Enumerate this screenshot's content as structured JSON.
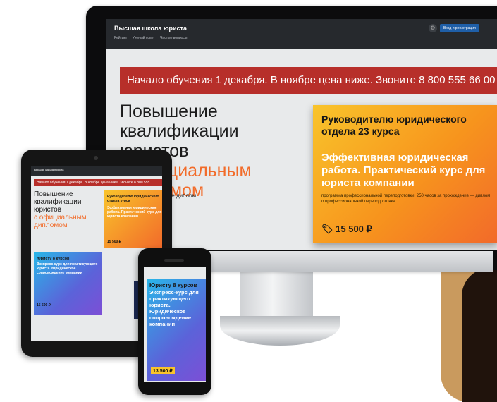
{
  "desktop": {
    "brand": "Высшая школа юриста",
    "nav_links": [
      "Рейтинг",
      "Ученый совет",
      "Частые вопросы"
    ],
    "login_label": "Вход и регистрация",
    "banner": "Начало обучения 1 декабря. В ноябре цена ниже. Звоните 8 800 555 66 00",
    "headline_black": "Повышение квалификации юристов",
    "headline_orange": "с официальным дипломом",
    "description": "программу, получите диплом",
    "card": {
      "title": "Руководителю юридического отдела 23 курса",
      "subtitle": "Эффективная юридическая работа. Практический курс для юриста компании",
      "note": "программа профессиональной переподготовки, 250 часов за прохождение — диплом о профессиональной переподготовке",
      "price": "15 500 ₽"
    }
  },
  "tablet": {
    "brand": "Высшая школа юриста",
    "banner": "Начало обучения 1 декабря. В ноябре цена ниже. Звоните 8 800 555",
    "headline_black": "Повышение квалификации юристов",
    "headline_orange": "с официальным дипломом",
    "card1_title": "Руководителю юридического отдела курса",
    "card1_sub": "Эффективная юридическая работа. Практический курс для юриста компании",
    "card1_price": "15 500 ₽",
    "card2_title": "Юристу 8 курсов",
    "card2_sub": "Экспресс-курс для практикующего юриста. Юридическое сопровождение компании",
    "card2_price": "15 500 ₽"
  },
  "phone": {
    "card_title": "Юристу 8 курсов",
    "card_sub": "Экспресс-курс для практикующего юриста. Юридическое сопровождение компании",
    "card_price": "13 500 ₽"
  },
  "colors": {
    "banner_red": "#b72f2a",
    "accent_orange": "#f26c2a",
    "card_yellow": "#f9c42b",
    "card_blue": "#29b6e8",
    "nav_dark": "#26292d"
  }
}
